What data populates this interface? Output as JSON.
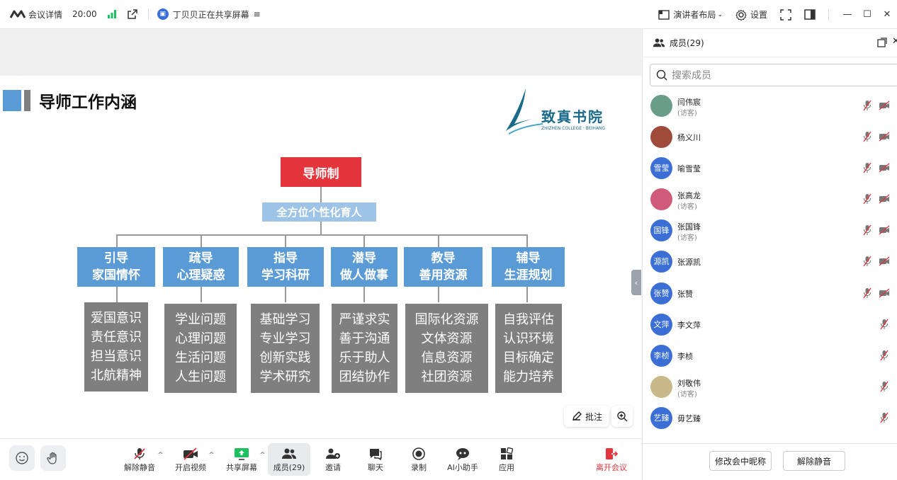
{
  "topbar": {
    "meeting_details": "会议详情",
    "duration": "20:00",
    "sharing_text": "丁贝贝正在共享屏幕",
    "layout_label": "演讲者布局",
    "settings_label": "设置"
  },
  "slide": {
    "title": "导师工作内涵",
    "logo_cn": "致真书院",
    "logo_en": "ZHIZHEN COLLEGE · BEIHANG",
    "root": "导师制",
    "subtitle": "全方位个性化育人",
    "categories": [
      {
        "line1": "引导",
        "line2": "家国情怀",
        "items": [
          "爱国意识",
          "责任意识",
          "担当意识",
          "北航精神"
        ]
      },
      {
        "line1": "疏导",
        "line2": "心理疑惑",
        "items": [
          "学业问题",
          "心理问题",
          "生活问题",
          "人生问题"
        ]
      },
      {
        "line1": "指导",
        "line2": "学习科研",
        "items": [
          "基础学习",
          "专业学习",
          "创新实践",
          "学术研究"
        ]
      },
      {
        "line1": "潜导",
        "line2": "做人做事",
        "items": [
          "严谨求实",
          "善于沟通",
          "乐于助人",
          "团结协作"
        ]
      },
      {
        "line1": "教导",
        "line2": "善用资源",
        "items": [
          "国际化资源",
          "文体资源",
          "信息资源",
          "社团资源"
        ]
      },
      {
        "line1": "辅导",
        "line2": "生涯规划",
        "items": [
          "自我评估",
          "认识环境",
          "目标确定",
          "能力培养"
        ]
      }
    ]
  },
  "float": {
    "annotate_label": "批注"
  },
  "toolbar": {
    "unmute": "解除静音",
    "start_video": "开启视频",
    "share_screen": "共享屏幕",
    "members": "成员(29)",
    "invite": "邀请",
    "chat": "聊天",
    "record": "录制",
    "ai_assistant": "AI小助手",
    "apps": "应用",
    "leave": "离开会议"
  },
  "panel": {
    "title": "成员(29)",
    "search_placeholder": "搜索成员",
    "guest_tag": "(访客)",
    "members": [
      {
        "name": "闫伟宸",
        "guest": true,
        "avatar_text": "",
        "avatar_color": "#6a9e8a",
        "camera": true
      },
      {
        "name": "杨义川",
        "guest": false,
        "avatar_text": "",
        "avatar_color": "#a04a3c",
        "camera": true
      },
      {
        "name": "喻雪莹",
        "guest": false,
        "avatar_text": "雪莹",
        "avatar_color": "#3b6fd6",
        "camera": true
      },
      {
        "name": "张高龙",
        "guest": true,
        "avatar_text": "",
        "avatar_color": "#d05a7a",
        "camera": true
      },
      {
        "name": "张国锋",
        "guest": true,
        "avatar_text": "国锋",
        "avatar_color": "#3b6fd6",
        "camera": true
      },
      {
        "name": "张源凯",
        "guest": false,
        "avatar_text": "源凯",
        "avatar_color": "#3b6fd6",
        "camera": true
      },
      {
        "name": "张赞",
        "guest": false,
        "avatar_text": "张赞",
        "avatar_color": "#3b6fd6",
        "camera": true
      },
      {
        "name": "李文萍",
        "guest": false,
        "avatar_text": "文萍",
        "avatar_color": "#3b6fd6",
        "camera": false
      },
      {
        "name": "李桢",
        "guest": false,
        "avatar_text": "李桢",
        "avatar_color": "#3b6fd6",
        "camera": false
      },
      {
        "name": "刘敬伟",
        "guest": true,
        "avatar_text": "",
        "avatar_color": "#c9b98a",
        "camera": false
      },
      {
        "name": "毋艺臻",
        "guest": false,
        "avatar_text": "艺臻",
        "avatar_color": "#3b6fd6",
        "camera": false
      }
    ],
    "rename_button": "修改会中昵称",
    "unmute_button": "解除静音"
  },
  "colors": {
    "accent": "#3b6fd6",
    "danger": "#e5353c",
    "slide_blue": "#5b9bd5",
    "slide_gray": "#7f7f7f",
    "signal": "#1dbf5f"
  }
}
